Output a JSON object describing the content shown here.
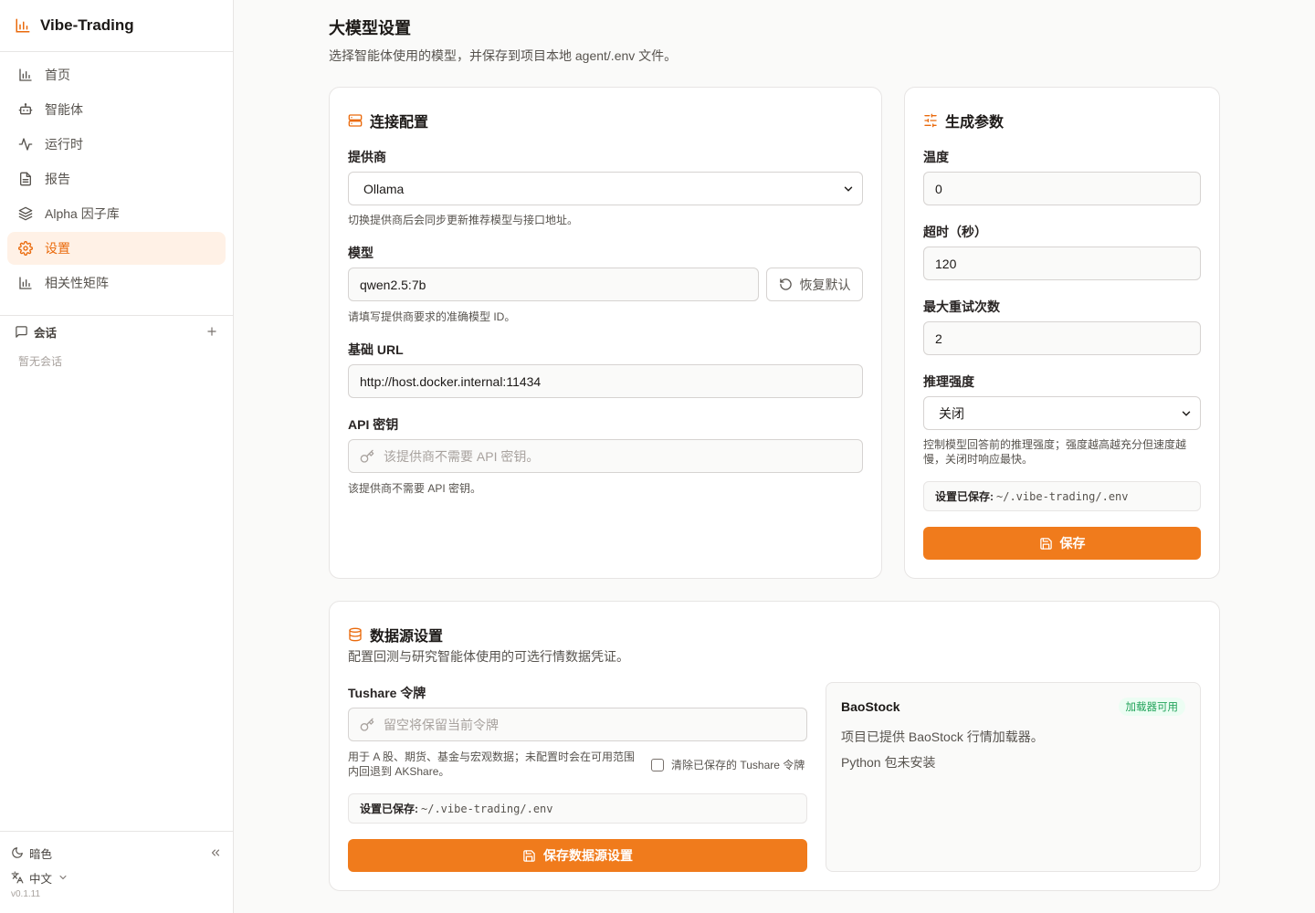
{
  "sidebar": {
    "brand": "Vibe-Trading",
    "nav": [
      {
        "label": "首页",
        "icon": "bar-chart-icon"
      },
      {
        "label": "智能体",
        "icon": "bot-icon"
      },
      {
        "label": "运行时",
        "icon": "activity-icon"
      },
      {
        "label": "报告",
        "icon": "file-text-icon"
      },
      {
        "label": "Alpha 因子库",
        "icon": "layers-icon"
      },
      {
        "label": "设置",
        "icon": "gear-icon",
        "active": true
      },
      {
        "label": "相关性矩阵",
        "icon": "bar-chart-icon"
      }
    ],
    "sessions_title": "会话",
    "sessions_empty": "暂无会话",
    "theme_label": "暗色",
    "language_label": "中文",
    "version": "v0.1.11"
  },
  "page": {
    "title": "大模型设置",
    "subtitle": "选择智能体使用的模型，并保存到项目本地 agent/.env 文件。"
  },
  "connection": {
    "title": "连接配置",
    "provider_label": "提供商",
    "provider_value": "Ollama",
    "provider_hint": "切换提供商后会同步更新推荐模型与接口地址。",
    "model_label": "模型",
    "model_value": "qwen2.5:7b",
    "reset_button": "恢复默认",
    "model_hint": "请填写提供商要求的准确模型 ID。",
    "base_url_label": "基础 URL",
    "base_url_value": "http://host.docker.internal:11434",
    "api_key_label": "API 密钥",
    "api_key_placeholder": "该提供商不需要 API 密钥。",
    "api_key_hint": "该提供商不需要 API 密钥。"
  },
  "generation": {
    "title": "生成参数",
    "temperature_label": "温度",
    "temperature_value": "0",
    "timeout_label": "超时（秒）",
    "timeout_value": "120",
    "retries_label": "最大重试次数",
    "retries_value": "2",
    "reasoning_label": "推理强度",
    "reasoning_value": "关闭",
    "reasoning_hint": "控制模型回答前的推理强度；强度越高越充分但速度越慢，关闭时响应最快。",
    "saved_label": "设置已保存:",
    "saved_path": "~/.vibe-trading/.env",
    "save_button": "保存"
  },
  "datasource": {
    "title": "数据源设置",
    "subtitle": "配置回测与研究智能体使用的可选行情数据凭证。",
    "tushare_label": "Tushare 令牌",
    "tushare_placeholder": "留空将保留当前令牌",
    "tushare_hint": "用于 A 股、期货、基金与宏观数据；未配置时会在可用范围内回退到 AKShare。",
    "clear_label": "清除已保存的 Tushare 令牌",
    "clear_checked": false,
    "saved_label": "设置已保存:",
    "saved_path": "~/.vibe-trading/.env",
    "save_button": "保存数据源设置",
    "baostock": {
      "name": "BaoStock",
      "badge": "加载器可用",
      "line1": "项目已提供 BaoStock 行情加载器。",
      "line2": "Python 包未安装"
    }
  },
  "colors": {
    "accent": "#f07b1c",
    "active_bg": "#fff1e6",
    "badge_bg": "#ecfdf3",
    "badge_text": "#22a35a"
  }
}
